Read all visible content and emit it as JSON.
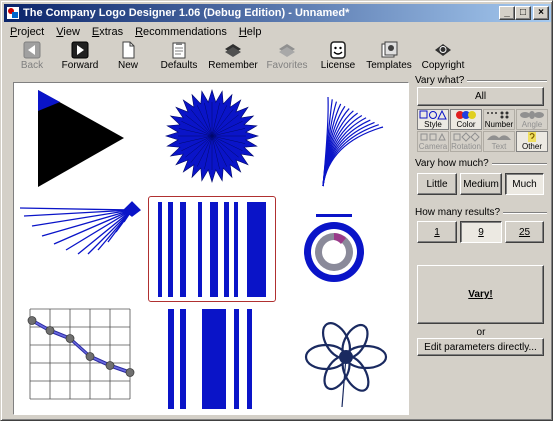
{
  "window": {
    "title": "The Company Logo Designer 1.06 (Debug Edition) - Unnamed*",
    "controls": {
      "minimize": "_",
      "maximize": "□",
      "close": "×"
    }
  },
  "menu": {
    "items": [
      {
        "label": "Project",
        "u": "P",
        "rest": "roject"
      },
      {
        "label": "View",
        "u": "V",
        "rest": "iew"
      },
      {
        "label": "Extras",
        "u": "E",
        "rest": "xtras"
      },
      {
        "label": "Recommendations",
        "u": "R",
        "rest": "ecommendations"
      },
      {
        "label": "Help",
        "u": "H",
        "rest": "elp"
      }
    ]
  },
  "toolbar": {
    "buttons": [
      {
        "label": "Back",
        "icon": "back-arrow-icon",
        "enabled": false
      },
      {
        "label": "Forward",
        "icon": "forward-arrow-icon",
        "enabled": true
      },
      {
        "label": "New",
        "icon": "new-document-icon",
        "enabled": true
      },
      {
        "label": "Defaults",
        "icon": "clipboard-icon",
        "enabled": true
      },
      {
        "label": "Remember",
        "icon": "books-icon",
        "enabled": true
      },
      {
        "label": "Favorites",
        "icon": "favorites-books-icon",
        "enabled": false
      },
      {
        "label": "License",
        "icon": "smiley-icon",
        "enabled": true
      },
      {
        "label": "Templates",
        "icon": "templates-icon",
        "enabled": true
      },
      {
        "label": "Copyright",
        "icon": "copyright-book-icon",
        "enabled": true
      }
    ]
  },
  "panel": {
    "vary_what": {
      "title": "Vary what?",
      "all_label": "All",
      "categories": [
        {
          "label": "Style",
          "active": true,
          "dim": false
        },
        {
          "label": "Color",
          "active": true,
          "dim": false
        },
        {
          "label": "Number",
          "active": false,
          "dim": false
        },
        {
          "label": "Angle",
          "active": false,
          "dim": true
        },
        {
          "label": "Camera",
          "active": false,
          "dim": true
        },
        {
          "label": "Rotation",
          "active": false,
          "dim": true
        },
        {
          "label": "Text",
          "active": false,
          "dim": true
        },
        {
          "label": "Other",
          "active": true,
          "dim": false
        }
      ]
    },
    "vary_how_much": {
      "title": "Vary how much?",
      "options": [
        "Little",
        "Medium",
        "Much"
      ],
      "selected": "Much"
    },
    "how_many": {
      "title": "How many results?",
      "options": [
        "1",
        "9",
        "25"
      ],
      "selected": "9"
    },
    "vary_button": "Vary!",
    "or_text": "or",
    "edit_params_button": "Edit parameters directly..."
  },
  "colors": {
    "logo_blue": "#0a14c8",
    "logo_navy": "#1a2a60",
    "selection_frame": "#b03030",
    "title_start": "#0a246a",
    "title_end": "#a6caf0"
  }
}
